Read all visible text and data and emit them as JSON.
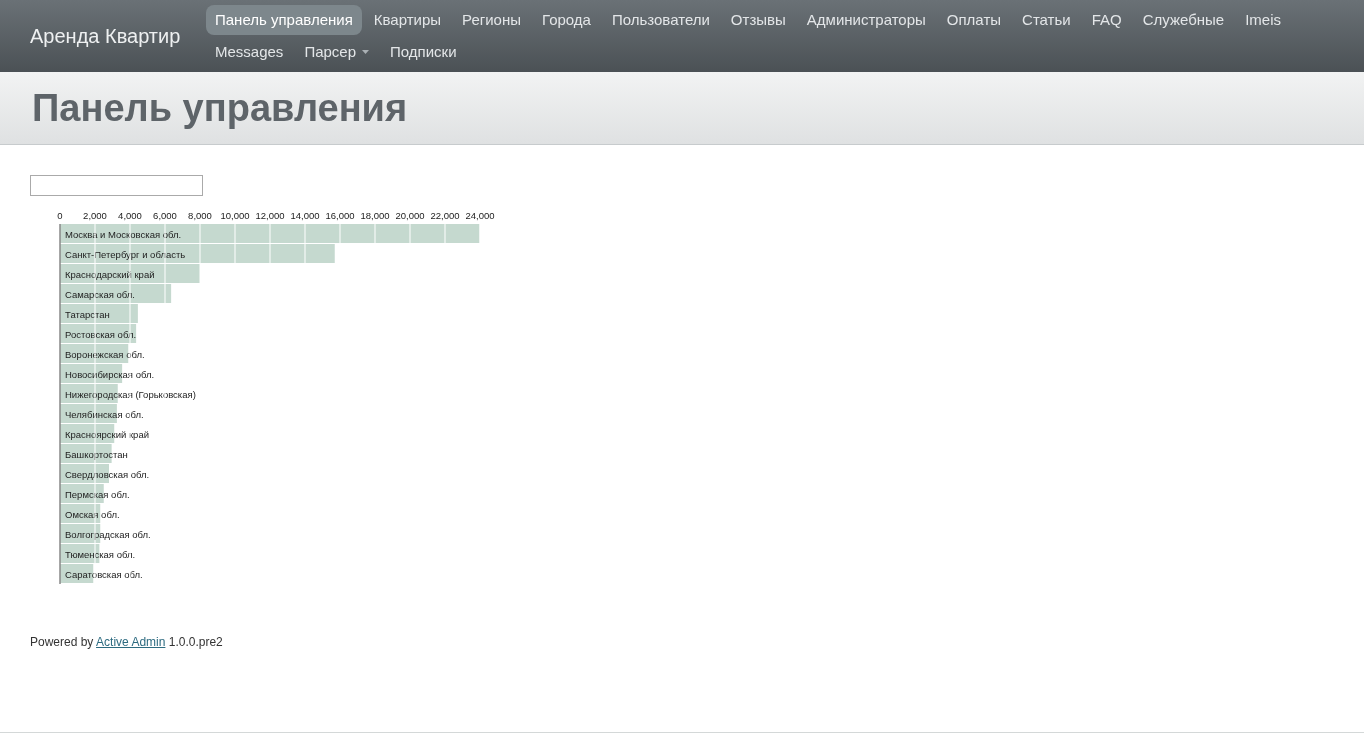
{
  "header": {
    "site_title": "Аренда Квартир",
    "nav": [
      {
        "label": "Панель управления",
        "selected": true
      },
      {
        "label": "Квартиры",
        "selected": false
      },
      {
        "label": "Регионы",
        "selected": false
      },
      {
        "label": "Города",
        "selected": false
      },
      {
        "label": "Пользователи",
        "selected": false
      },
      {
        "label": "Отзывы",
        "selected": false
      },
      {
        "label": "Администраторы",
        "selected": false
      },
      {
        "label": "Оплаты",
        "selected": false
      },
      {
        "label": "Статьи",
        "selected": false
      },
      {
        "label": "FAQ",
        "selected": false
      },
      {
        "label": "Служебные",
        "selected": false
      },
      {
        "label": "Imeis",
        "selected": false
      },
      {
        "label": "Messages",
        "selected": false
      },
      {
        "label": "Парсер",
        "selected": false,
        "dropdown": true
      },
      {
        "label": "Подписки",
        "selected": false
      }
    ]
  },
  "title_bar": {
    "title": "Панель управления"
  },
  "main": {
    "chart_data": {
      "type": "bar",
      "orientation": "horizontal",
      "grid": true,
      "categories": [
        "Москва и Московская обл.",
        "Санкт-Петербург и область",
        "Краснодарский край",
        "Самарская обл.",
        "Татарстан",
        "Ростовская обл.",
        "Воронежская обл.",
        "Новосибирская обл.",
        "Нижегородская (Горьковская)",
        "Челябинская обл.",
        "Красноярский край",
        "Башкортостан",
        "Свердловская обл.",
        "Пермская обл.",
        "Омская обл.",
        "Волгоградская обл.",
        "Тюменская обл.",
        "Саратовская обл."
      ],
      "values": [
        24000,
        15700,
        8000,
        6350,
        4450,
        4350,
        3900,
        3550,
        3300,
        3250,
        3100,
        2950,
        2800,
        2500,
        2300,
        2300,
        2250,
        1900
      ],
      "xlim": [
        0,
        24000
      ],
      "xticks": [
        {
          "value": 0,
          "label": "0"
        },
        {
          "value": 2000,
          "label": "2,000"
        },
        {
          "value": 4000,
          "label": "4,000"
        },
        {
          "value": 6000,
          "label": "6,000"
        },
        {
          "value": 8000,
          "label": "8,000"
        },
        {
          "value": 10000,
          "label": "10,000"
        },
        {
          "value": 12000,
          "label": "12,000"
        },
        {
          "value": 14000,
          "label": "14,000"
        },
        {
          "value": 16000,
          "label": "16,000"
        },
        {
          "value": 18000,
          "label": "18,000"
        },
        {
          "value": 20000,
          "label": "20,000"
        },
        {
          "value": 22000,
          "label": "22,000"
        },
        {
          "value": 24000,
          "label": "24,000"
        }
      ]
    }
  },
  "footer": {
    "prefix": "Powered by",
    "link": "Active Admin",
    "suffix": "1.0.0.pre2"
  }
}
